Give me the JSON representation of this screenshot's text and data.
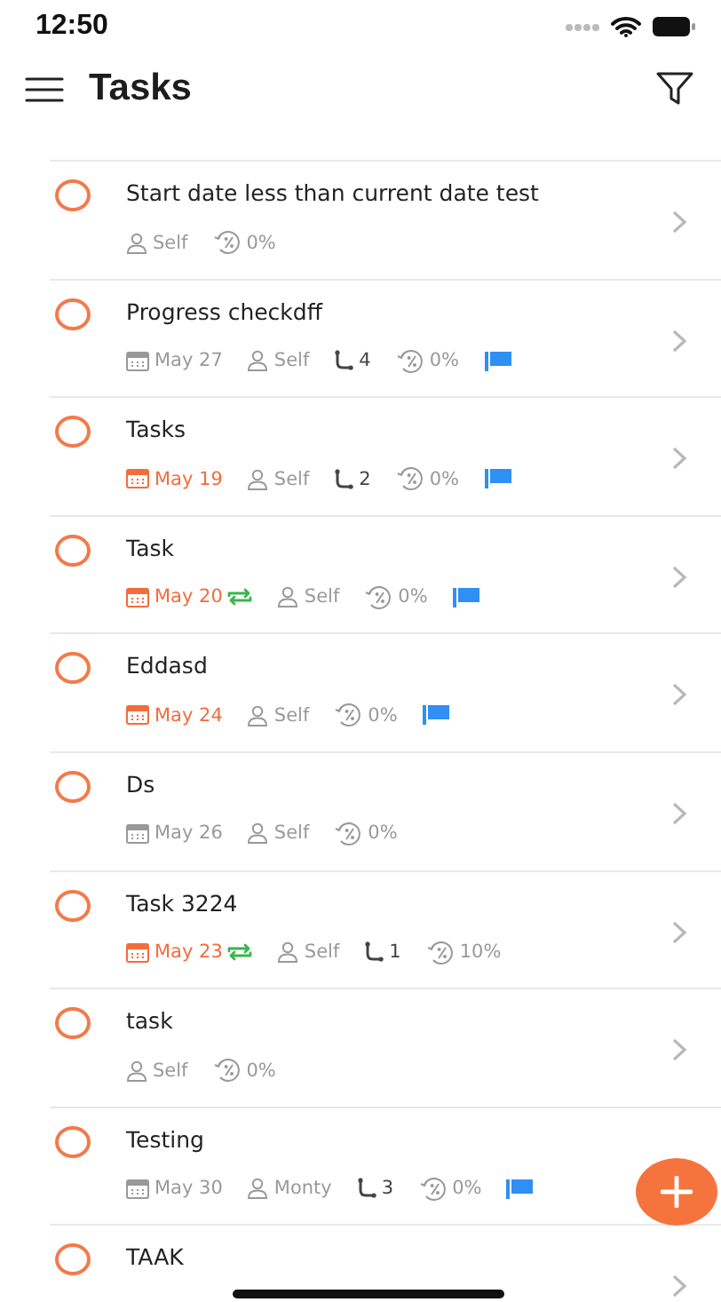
{
  "status_bar": {
    "time": "12:50"
  },
  "header": {
    "title": "Tasks"
  },
  "tasks": [
    {
      "title": "Start date less than current date test",
      "done": false,
      "assignee": "Self",
      "progress": "0%",
      "flagged": false
    },
    {
      "title": "Progress checkdff",
      "done": false,
      "date": "May 27",
      "overdue": false,
      "repeat": false,
      "assignee": "Self",
      "subtasks": "4",
      "progress": "0%",
      "flagged": true
    },
    {
      "title": "Tasks",
      "done": false,
      "date": "May 19",
      "overdue": true,
      "repeat": false,
      "assignee": "Self",
      "subtasks": "2",
      "progress": "0%",
      "flagged": true
    },
    {
      "title": "Task",
      "done": false,
      "date": "May 20",
      "overdue": true,
      "repeat": true,
      "assignee": "Self",
      "progress": "0%",
      "flagged": true
    },
    {
      "title": "Eddasd",
      "done": false,
      "date": "May 24",
      "overdue": true,
      "repeat": false,
      "assignee": "Self",
      "progress": "0%",
      "flagged": true
    },
    {
      "title": "Ds",
      "done": false,
      "date": "May 26",
      "overdue": false,
      "repeat": false,
      "assignee": "Self",
      "progress": "0%",
      "flagged": false
    },
    {
      "title": "Task 3224",
      "done": false,
      "date": "May 23",
      "overdue": true,
      "repeat": true,
      "assignee": "Self",
      "subtasks": "1",
      "progress": "10%",
      "flagged": false
    },
    {
      "title": "task",
      "done": false,
      "assignee": "Self",
      "progress": "0%",
      "flagged": false
    },
    {
      "title": "Testing",
      "done": false,
      "date": "May 30",
      "overdue": false,
      "repeat": false,
      "assignee": "Monty",
      "subtasks": "3",
      "progress": "0%",
      "flagged": true
    },
    {
      "title": "TAAK",
      "done": false
    }
  ]
}
